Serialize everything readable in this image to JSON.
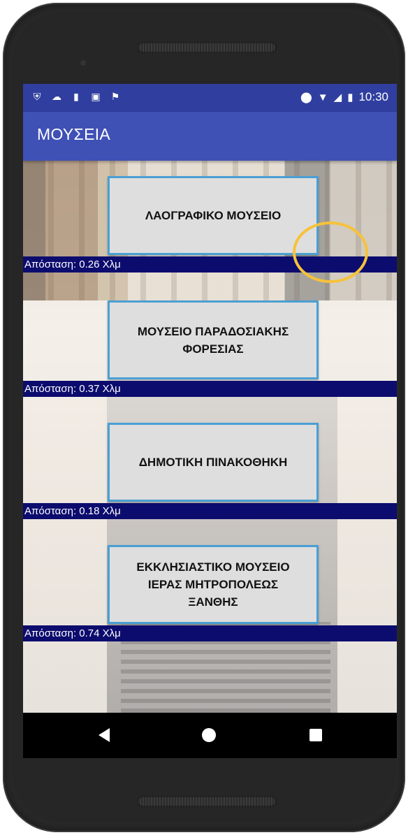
{
  "status_bar": {
    "left_icons": [
      "shield-icon",
      "cloud-icon",
      "sd-card-icon",
      "image-icon",
      "flag-icon"
    ],
    "right_icons": [
      "location-icon",
      "wifi-icon",
      "signal-icon",
      "battery-icon"
    ],
    "time": "10:30"
  },
  "app_bar": {
    "title": "ΜΟΥΣΕΙΑ"
  },
  "museums": [
    {
      "name": "ΛΑΟΓΡΑΦΙΚΟ ΜΟΥΣΕΙΟ",
      "distance": "Απόσταση: 0.26 Χλμ"
    },
    {
      "name": "ΜΟΥΣΕΙΟ ΠΑΡΑΔΟΣΙΑΚΗΣ\nΦΟΡΕΣΙΑΣ",
      "distance": "Απόσταση: 0.37 Χλμ"
    },
    {
      "name": "ΔΗΜΟΤΙΚΗ ΠΙΝΑΚΟΘΗΚΗ",
      "distance": "Απόσταση: 0.18 Χλμ"
    },
    {
      "name": "ΕΚΚΛΗΣΙΑΣΤΙΚΟ ΜΟΥΣΕΙΟ\nΙΕΡΑΣ ΜΗΤΡΟΠΟΛΕΩΣ\nΞΑΝΘΗΣ",
      "distance": "Απόσταση: 0.74 Χλμ"
    }
  ],
  "colors": {
    "status_bar": "#303f9f",
    "app_bar": "#3f51b5",
    "button_border": "#4a9fd4",
    "distance_bar": "#0c0c6e",
    "touch_indicator": "#f7c23a"
  }
}
